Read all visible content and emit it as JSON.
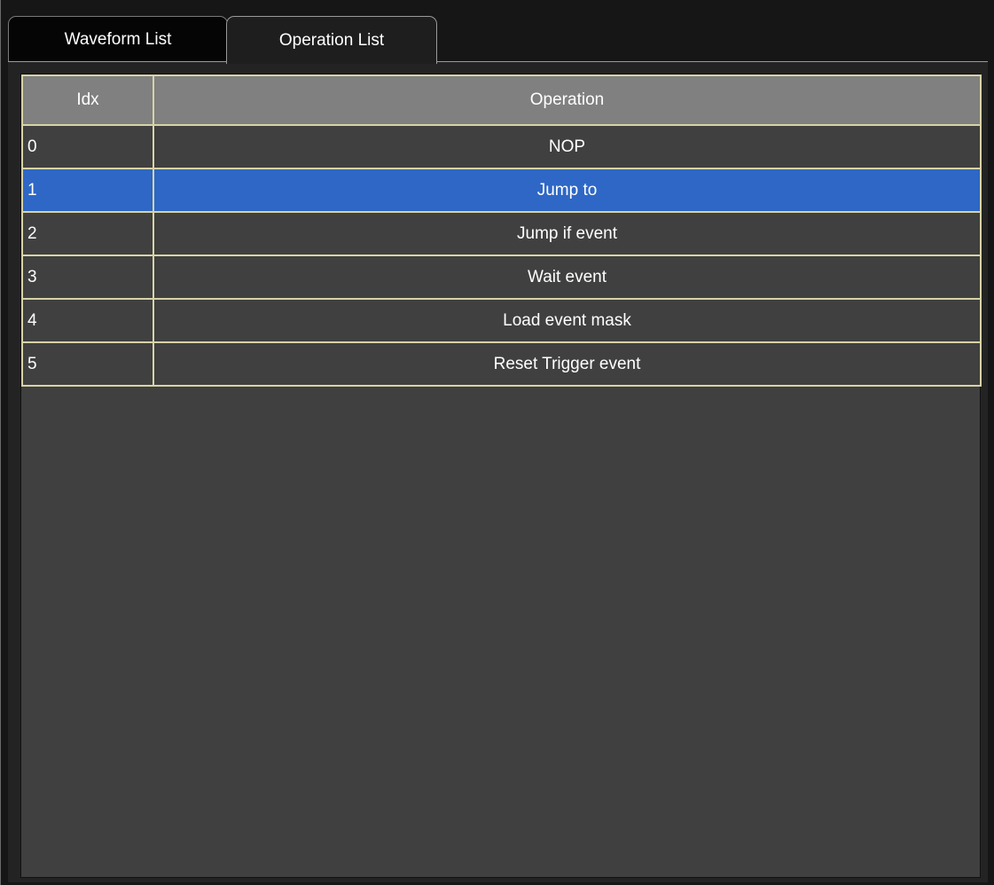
{
  "tabs": [
    {
      "label": "Waveform List",
      "active": false
    },
    {
      "label": "Operation List",
      "active": true
    }
  ],
  "table": {
    "columns": [
      "Idx",
      "Operation"
    ],
    "selected_index": 1,
    "rows": [
      {
        "idx": "0",
        "operation": "NOP"
      },
      {
        "idx": "1",
        "operation": "Jump to"
      },
      {
        "idx": "2",
        "operation": "Jump if event"
      },
      {
        "idx": "3",
        "operation": "Wait event"
      },
      {
        "idx": "4",
        "operation": "Load event mask"
      },
      {
        "idx": "5",
        "operation": "Reset Trigger event"
      }
    ]
  },
  "colors": {
    "selected_row": "#2e67c5",
    "grid_border": "#d8d3a6",
    "header_bg": "#808080",
    "row_bg": "#404040"
  }
}
